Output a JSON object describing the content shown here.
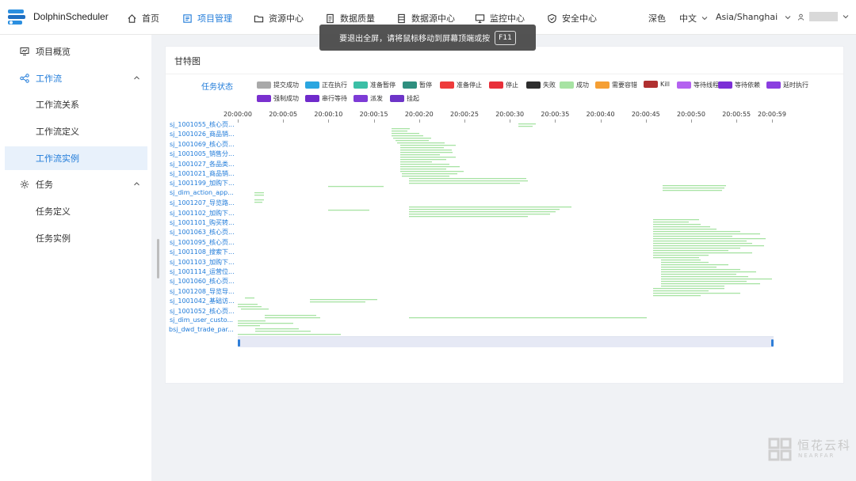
{
  "app": {
    "name": "DolphinScheduler"
  },
  "topnav": [
    {
      "label": "首页",
      "icon": "home-icon"
    },
    {
      "label": "项目管理",
      "icon": "project-icon",
      "active": true
    },
    {
      "label": "资源中心",
      "icon": "folder-icon"
    },
    {
      "label": "数据质量",
      "icon": "document-icon"
    },
    {
      "label": "数据源中心",
      "icon": "database-icon"
    },
    {
      "label": "监控中心",
      "icon": "monitor-icon"
    },
    {
      "label": "安全中心",
      "icon": "shield-icon"
    }
  ],
  "topright": {
    "theme": "深色",
    "language": "中文",
    "timezone": "Asia/Shanghai"
  },
  "toast": {
    "text": "要退出全屏，请将鼠标移动到屏幕顶端或按",
    "key": "F11"
  },
  "sidebar": {
    "items": [
      {
        "label": "项目概览",
        "icon": "overview-icon"
      },
      {
        "label": "工作流",
        "icon": "workflow-icon"
      },
      {
        "label": "工作流关系"
      },
      {
        "label": "工作流定义"
      },
      {
        "label": "工作流实例",
        "active": true
      },
      {
        "label": "任务",
        "icon": "gear-icon"
      },
      {
        "label": "任务定义"
      },
      {
        "label": "任务实例"
      }
    ]
  },
  "card": {
    "title": "甘特图"
  },
  "legend": {
    "title": "任务状态",
    "items": [
      {
        "label": "提交成功",
        "color": "#a9a9a9"
      },
      {
        "label": "正在执行",
        "color": "#2ba6e0"
      },
      {
        "label": "准备暂停",
        "color": "#3bbfa6"
      },
      {
        "label": "暂停",
        "color": "#2f8f7f"
      },
      {
        "label": "准备停止",
        "color": "#ee3b3b"
      },
      {
        "label": "停止",
        "color": "#e8303a"
      },
      {
        "label": "失败",
        "color": "#2d2d2d"
      },
      {
        "label": "成功",
        "color": "#a7e3a3"
      },
      {
        "label": "需要容错",
        "color": "#f59f34"
      },
      {
        "label": "Kill",
        "color": "#b03030"
      },
      {
        "label": "等待线程",
        "color": "#b462f0"
      },
      {
        "label": "等待依赖",
        "color": "#7c2fd6"
      },
      {
        "label": "延时执行",
        "color": "#8a3ee0"
      },
      {
        "label": "强制成功",
        "color": "#7a30cf"
      },
      {
        "label": "串行等待",
        "color": "#6f2acb"
      },
      {
        "label": "派发",
        "color": "#7d3bd6"
      },
      {
        "label": "挂起",
        "color": "#6d34c8"
      }
    ]
  },
  "time_axis": [
    "20:00:00",
    "20:00:05",
    "20:00:10",
    "20:00:15",
    "20:00:20",
    "20:00:25",
    "20:00:30",
    "20:00:35",
    "20:00:40",
    "20:00:45",
    "20:00:50",
    "20:00:55",
    "20:00:59"
  ],
  "rows": [
    "sj_1001055_核心页...",
    "sj_1001026_商品销...",
    "sj_1001069_核心页...",
    "sj_1001005_销售分...",
    "sj_1001027_各品类...",
    "sj_1001021_商品销...",
    "sj_1001199_加购下...",
    "sj_dim_action_app...",
    "sj_1001207_导览路...",
    "sj_1001102_加购下...",
    "sj_1001101_购买转...",
    "sj_1001063_核心页...",
    "sj_1001095_核心页...",
    "sj_1001108_搜索下...",
    "sj_1001103_加购下...",
    "sj_1001114_运营位...",
    "sj_1001060_核心页...",
    "sj_1001208_导览导...",
    "sj_1001042_基础访...",
    "sj_1001052_核心页...",
    "sj_dim_user_custo...",
    "bsj_dwd_trade_par..."
  ],
  "watermark": {
    "name": "恒花云科",
    "en": "NEARFAR"
  }
}
